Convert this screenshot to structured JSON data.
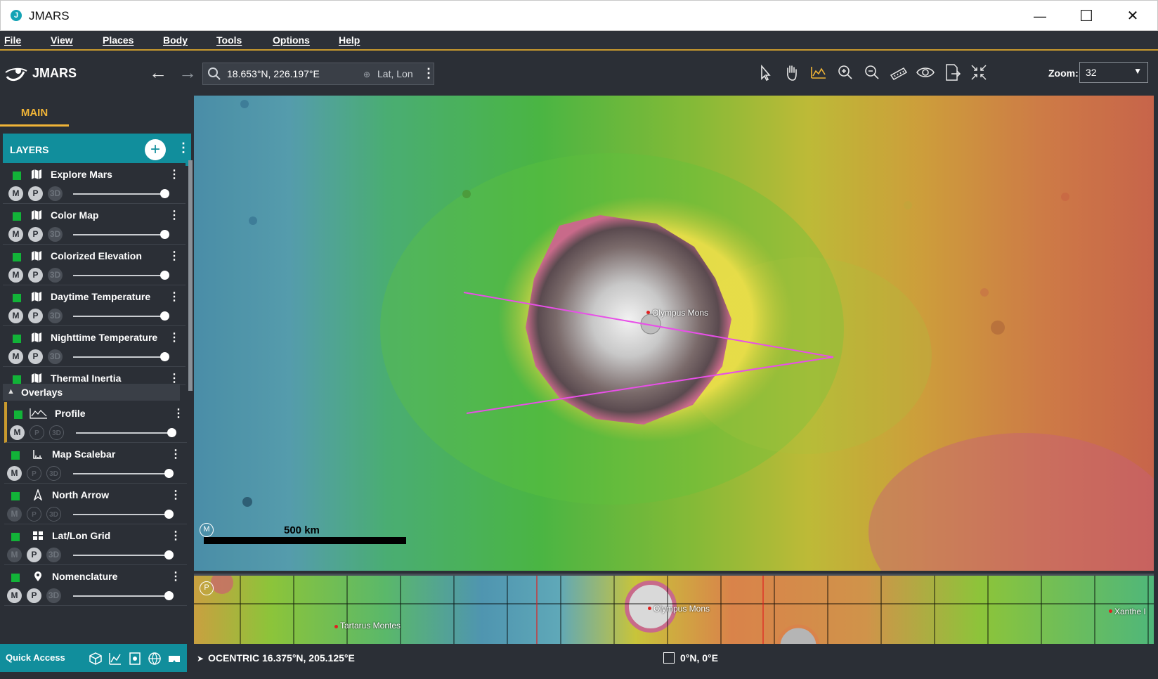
{
  "window": {
    "title": "JMARS",
    "minimize": "—",
    "maximize": "☐",
    "close": "✕",
    "app_icon": "J"
  },
  "menu": [
    "File",
    "View",
    "Places",
    "Body",
    "Tools",
    "Options",
    "Help"
  ],
  "toolbar": {
    "logo_text": "JMARS",
    "back": "←",
    "forward": "→",
    "search_value": "18.653°N, 226.197°E",
    "coord_mode": "Lat, Lon",
    "more": "⋮",
    "tools": [
      "pointer-icon",
      "hand-icon",
      "profile-chart-icon",
      "zoom-in-icon",
      "zoom-out-icon",
      "ruler-icon",
      "eye-icon",
      "export-icon",
      "fit-icon"
    ],
    "zoom_label": "Zoom:",
    "zoom_value": "32"
  },
  "left_panel": {
    "tab": "MAIN",
    "layers_title": "LAYERS",
    "add": "+",
    "more": "⋮",
    "layers": [
      {
        "name": "Explore Mars",
        "icon": "map-icon"
      },
      {
        "name": "Color Map",
        "icon": "map-icon"
      },
      {
        "name": "Colorized Elevation",
        "icon": "map-icon"
      },
      {
        "name": "Daytime Temperature",
        "icon": "map-icon"
      },
      {
        "name": "Nighttime Temperature",
        "icon": "map-icon"
      },
      {
        "name": "Thermal Inertia",
        "icon": "map-icon"
      }
    ],
    "overlays_title": "Overlays",
    "overlays": [
      {
        "name": "Profile",
        "icon": "profile-icon"
      },
      {
        "name": "Map Scalebar",
        "icon": "scalebar-icon"
      },
      {
        "name": "North Arrow",
        "icon": "north-arrow-icon"
      },
      {
        "name": "Lat/Lon Grid",
        "icon": "grid-icon"
      },
      {
        "name": "Nomenclature",
        "icon": "pin-icon"
      }
    ],
    "pill_m": "M",
    "pill_p": "P",
    "pill_3d": "3D"
  },
  "map": {
    "main_label": "Olympus Mons",
    "scalebar": "500 km",
    "badge_m": "M",
    "badge_p": "P",
    "minimap_labels": [
      "Tartarus Montes",
      "Olympus Mons",
      "Xanthe I"
    ]
  },
  "status": {
    "quick_access": "Quick Access",
    "cursor_coord": "OCENTRIC  16.375°N, 205.125°E",
    "center_coord": "0°N, 0°E"
  },
  "colors": {
    "accent": "#c99a2e",
    "teal": "#118e9c",
    "layer_on": "#12b338",
    "profile_line": "#e84fe8"
  }
}
